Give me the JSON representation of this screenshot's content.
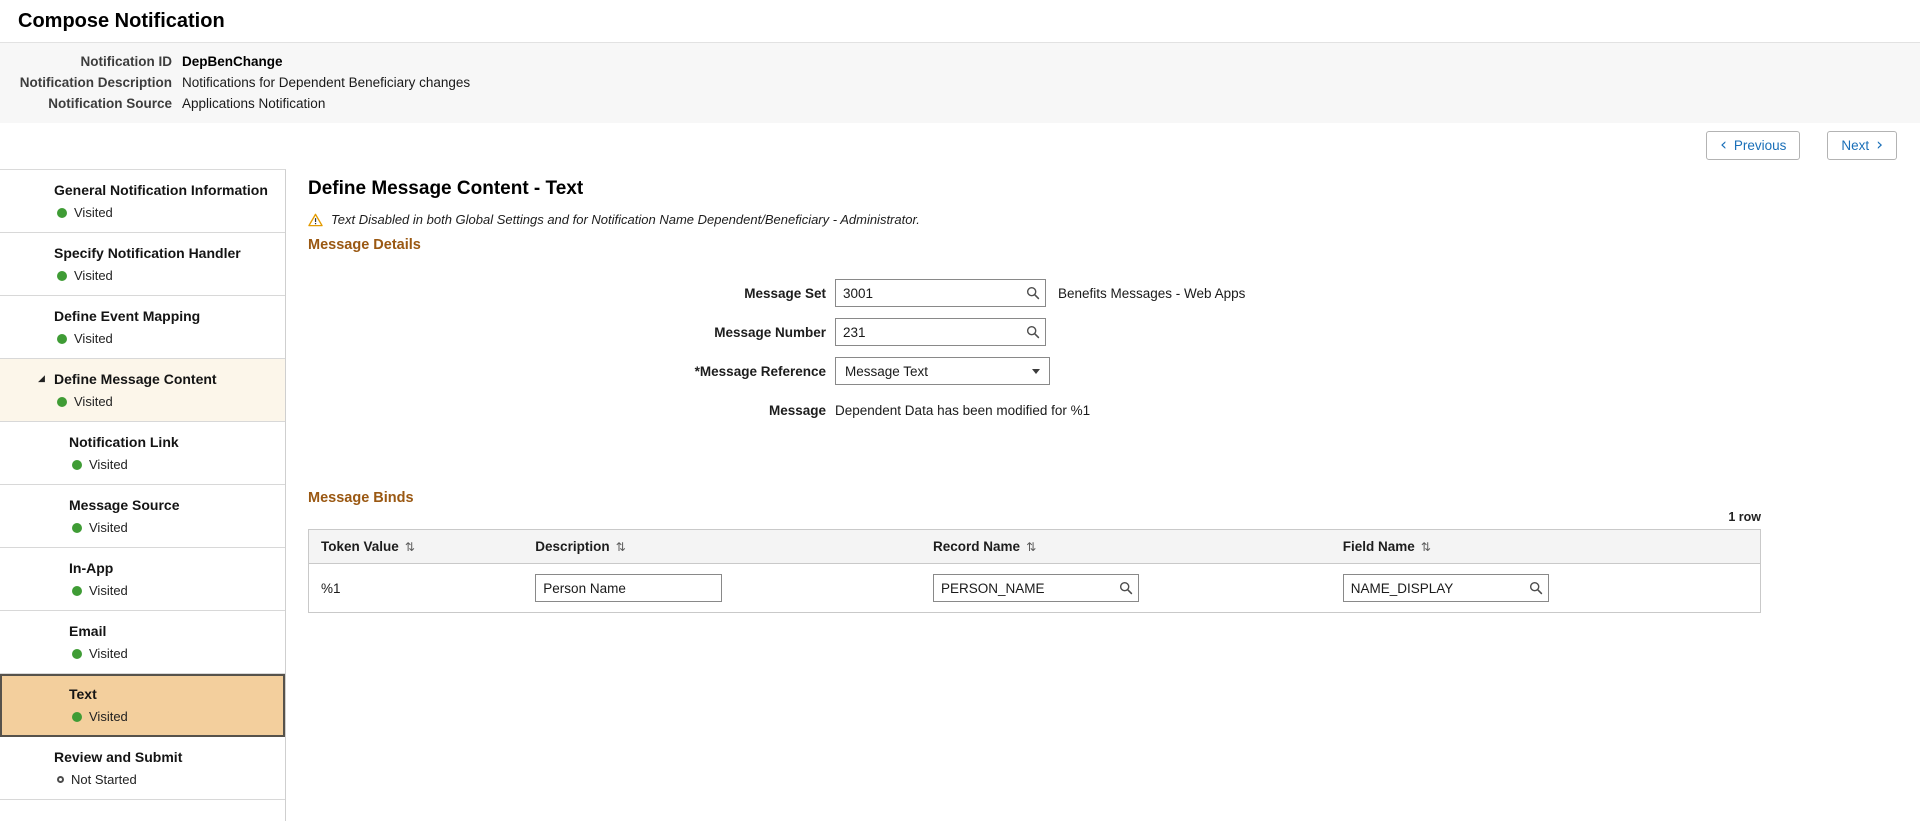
{
  "page": {
    "title": "Compose Notification"
  },
  "info": {
    "rows": [
      {
        "label": "Notification ID",
        "value": "DepBenChange"
      },
      {
        "label": "Notification Description",
        "value": "Notifications for Dependent Beneficiary changes"
      },
      {
        "label": "Notification Source",
        "value": "Applications Notification"
      }
    ]
  },
  "nav": {
    "previous": "Previous",
    "next": "Next"
  },
  "icons": {
    "previous_chevron": "‹",
    "next_chevron": "›",
    "sort": "⇅",
    "expander": "◢",
    "lookup": "magnifier",
    "warning": "warning-triangle",
    "select_caret": "caret-down",
    "visited_dot": "filled-green-circle",
    "not_started_dot": "hollow-circle"
  },
  "sidebar": {
    "items": [
      {
        "label": "General Notification Information",
        "status": "Visited"
      },
      {
        "label": "Specify Notification Handler",
        "status": "Visited"
      },
      {
        "label": "Define Event Mapping",
        "status": "Visited"
      },
      {
        "label": "Define Message Content",
        "status": "Visited"
      },
      {
        "label": "Notification Link",
        "status": "Visited"
      },
      {
        "label": "Message Source",
        "status": "Visited"
      },
      {
        "label": "In-App",
        "status": "Visited"
      },
      {
        "label": "Email",
        "status": "Visited"
      },
      {
        "label": "Text",
        "status": "Visited"
      },
      {
        "label": "Review and Submit",
        "status": "Not Started"
      }
    ]
  },
  "main": {
    "title": "Define Message Content - Text",
    "warning": "Text Disabled in both Global Settings and for Notification Name Dependent/Beneficiary - Administrator.",
    "sections": {
      "details_heading": "Message Details",
      "binds_heading": "Message Binds"
    },
    "form": {
      "message_set": {
        "label": "Message Set",
        "value": "3001",
        "description": "Benefits Messages - Web Apps"
      },
      "message_number": {
        "label": "Message Number",
        "value": "231"
      },
      "message_reference": {
        "label": "*Message Reference",
        "value": "Message Text"
      },
      "message": {
        "label": "Message",
        "value": "Dependent Data has been modified for %1"
      }
    },
    "binds": {
      "row_count": "1 row",
      "columns": [
        "Token Value",
        "Description",
        "Record Name",
        "Field Name"
      ],
      "rows": [
        {
          "token_value": "%1",
          "description": "Person Name",
          "record_name": "PERSON_NAME",
          "field_name": "NAME_DISPLAY"
        }
      ]
    }
  },
  "colors": {
    "section_heading": "#9a5812",
    "active_item_bg": "#f3cf9d",
    "visited_green": "#3f9c35",
    "link_blue": "#1a6fb8"
  }
}
